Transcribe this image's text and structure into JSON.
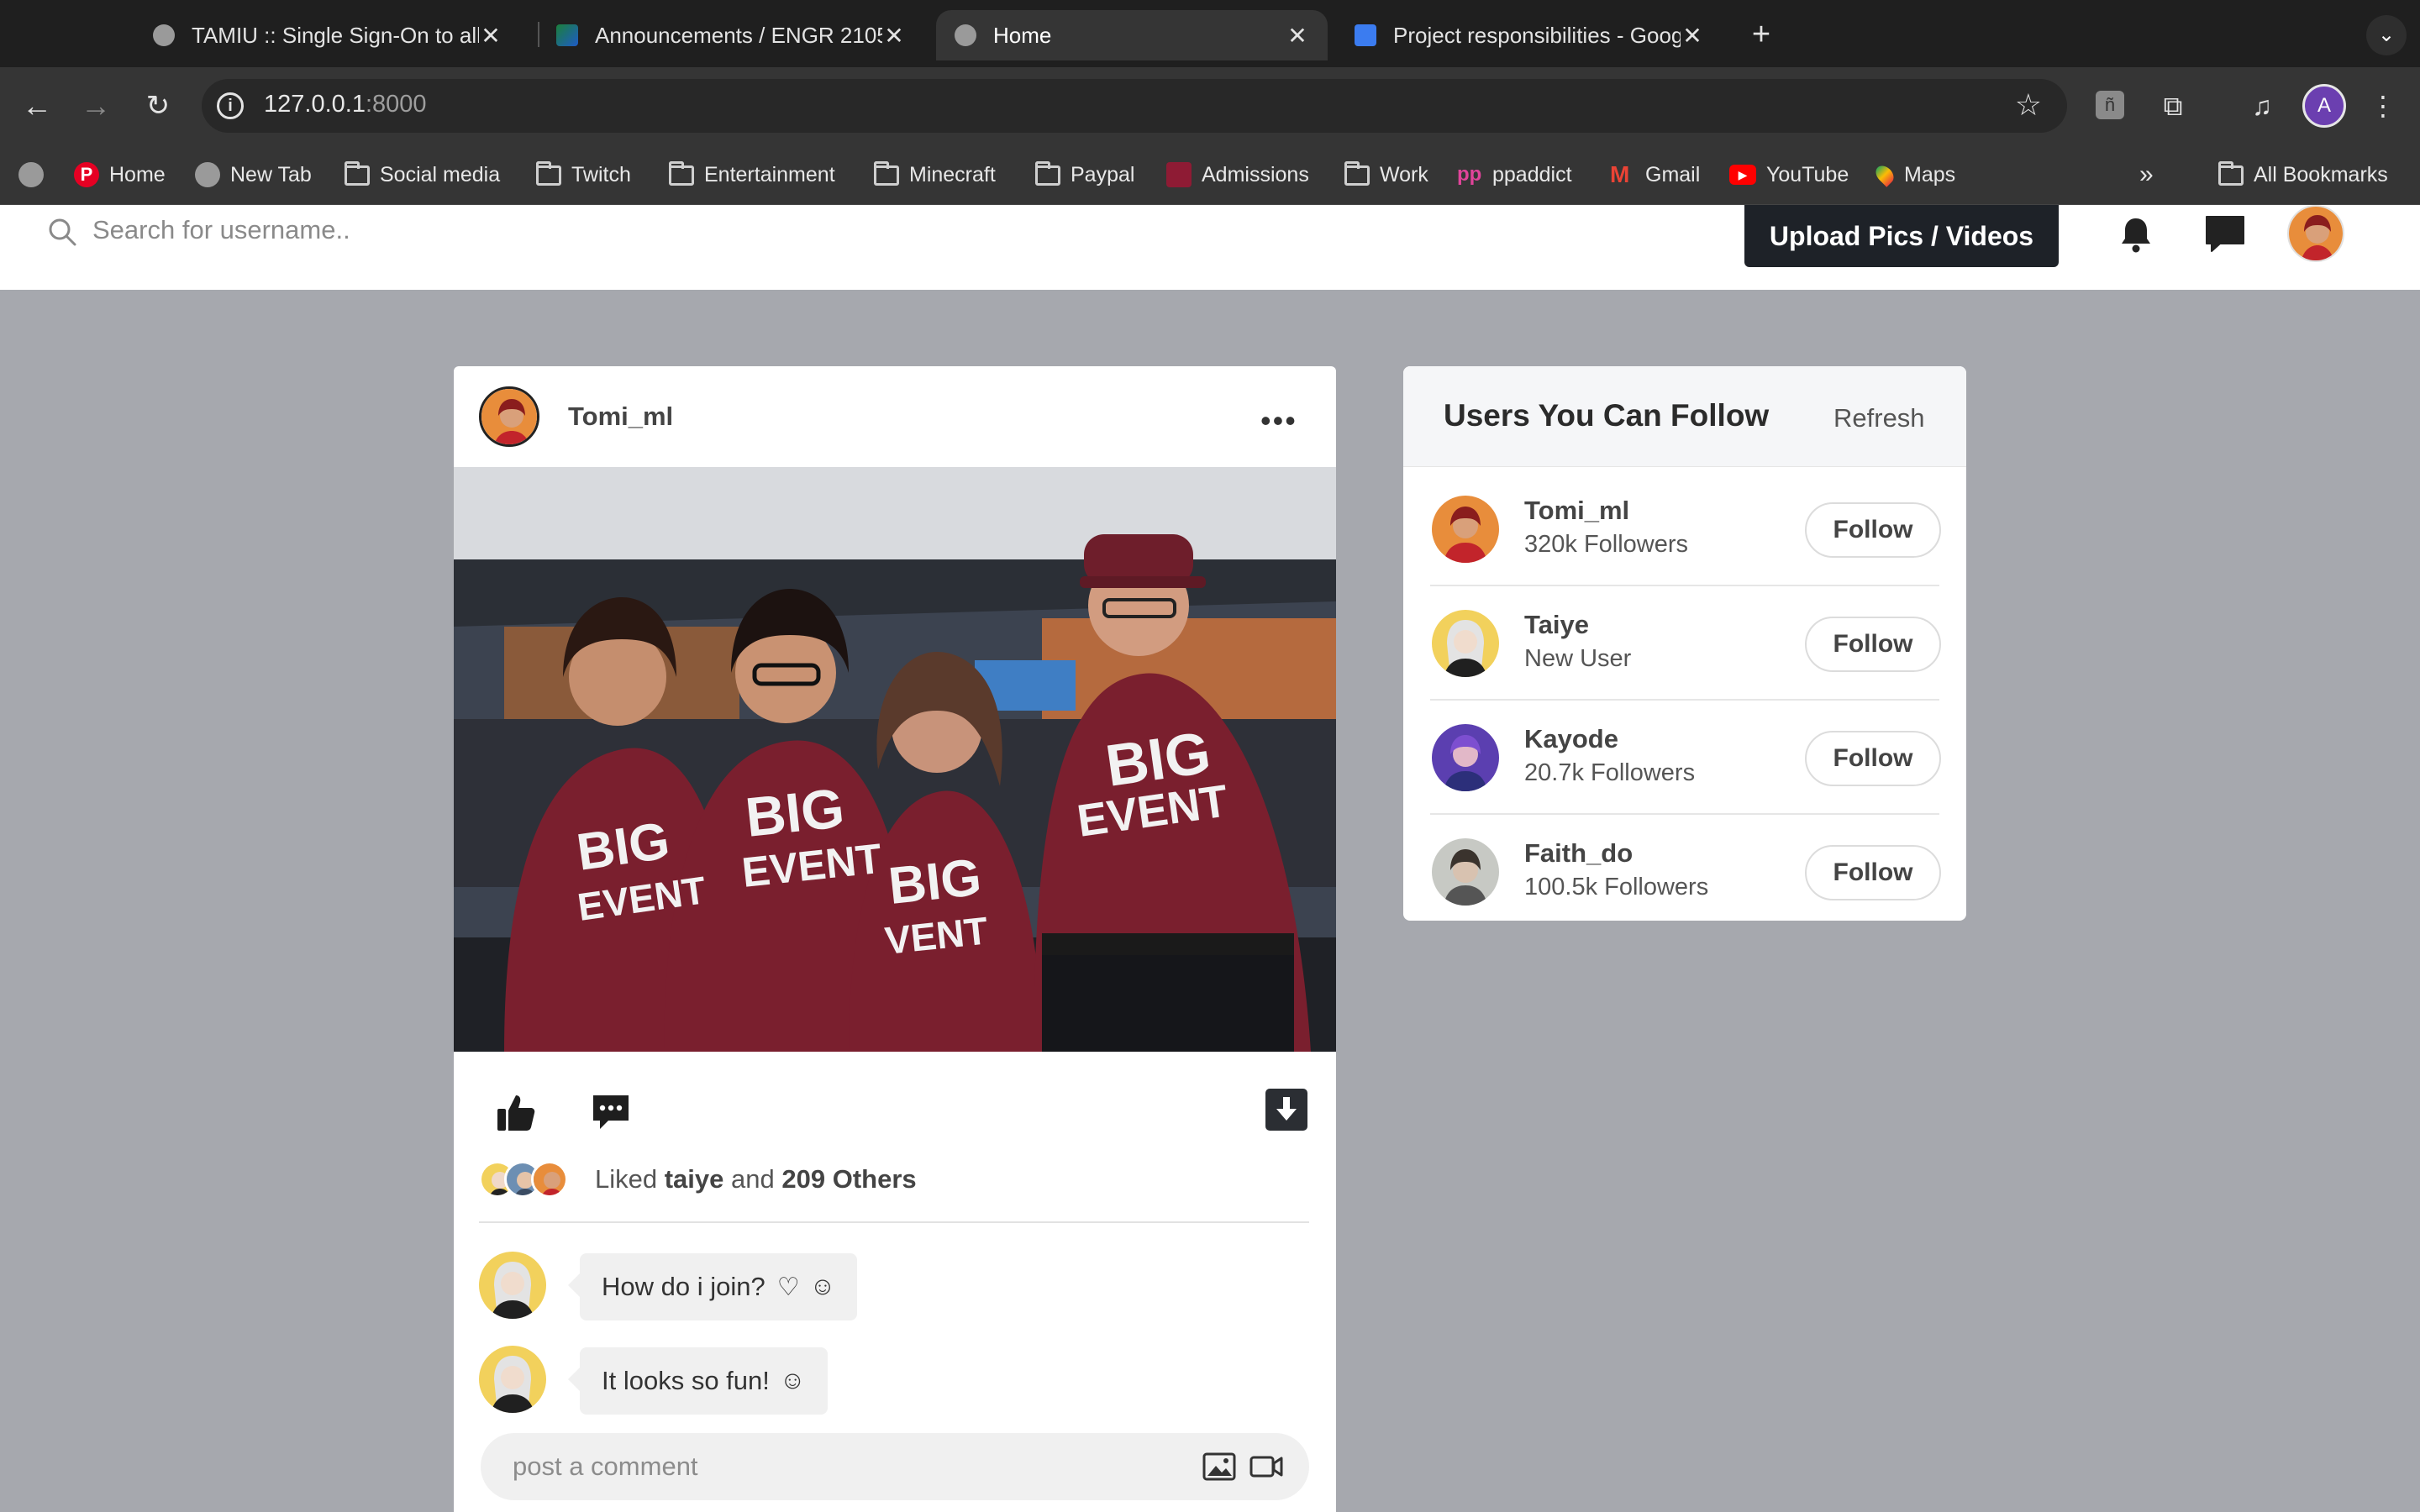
{
  "browser": {
    "tabs": [
      {
        "title": "TAMIU :: Single Sign-On to all",
        "active": false
      },
      {
        "title": "Announcements / ENGR 2105",
        "active": false
      },
      {
        "title": "Home",
        "active": true
      },
      {
        "title": "Project responsibilities - Goog",
        "active": false
      }
    ],
    "url_host": "127.0.0.1",
    "url_port": ":8000",
    "profile_initial": "A",
    "bookmarks": [
      {
        "label": "Home",
        "icon": "pinterest-icon"
      },
      {
        "label": "New Tab",
        "icon": "globe-icon"
      },
      {
        "label": "Social media",
        "icon": "folder-icon"
      },
      {
        "label": "Twitch",
        "icon": "folder-icon"
      },
      {
        "label": "Entertainment",
        "icon": "folder-icon"
      },
      {
        "label": "Minecraft",
        "icon": "folder-icon"
      },
      {
        "label": "Paypal",
        "icon": "folder-icon"
      },
      {
        "label": "Admissions",
        "icon": "admissions-icon"
      },
      {
        "label": "Work",
        "icon": "folder-icon"
      },
      {
        "label": "ppaddict",
        "icon": "ppaddict-icon"
      },
      {
        "label": "Gmail",
        "icon": "gmail-icon"
      },
      {
        "label": "YouTube",
        "icon": "youtube-icon"
      },
      {
        "label": "Maps",
        "icon": "maps-icon"
      }
    ],
    "all_bookmarks": "All Bookmarks"
  },
  "header": {
    "search_placeholder": "Search for username..",
    "upload_label": "Upload Pics / Videos"
  },
  "post": {
    "username": "Tomi_ml",
    "liked_prefix": "Liked",
    "liked_user": "taiye",
    "liked_and": "and",
    "liked_others": "209 Others",
    "comments": [
      {
        "text": "How do i join?"
      },
      {
        "text": "It looks so fun!"
      }
    ],
    "comment_placeholder": "post a comment"
  },
  "suggestions": {
    "title": "Users You Can Follow",
    "refresh_label": "Refresh",
    "follow_label": "Follow",
    "users": [
      {
        "name": "Tomi_ml",
        "followers": "320k Followers"
      },
      {
        "name": "Taiye",
        "followers": "New User"
      },
      {
        "name": "Kayode",
        "followers": "20.7k Followers"
      },
      {
        "name": "Faith_do",
        "followers": "100.5k Followers"
      }
    ]
  },
  "colors": {
    "page_bg": "#a6a8ae",
    "upload_button": "#1e2228",
    "shirt_maroon": "#7a1f2e"
  }
}
